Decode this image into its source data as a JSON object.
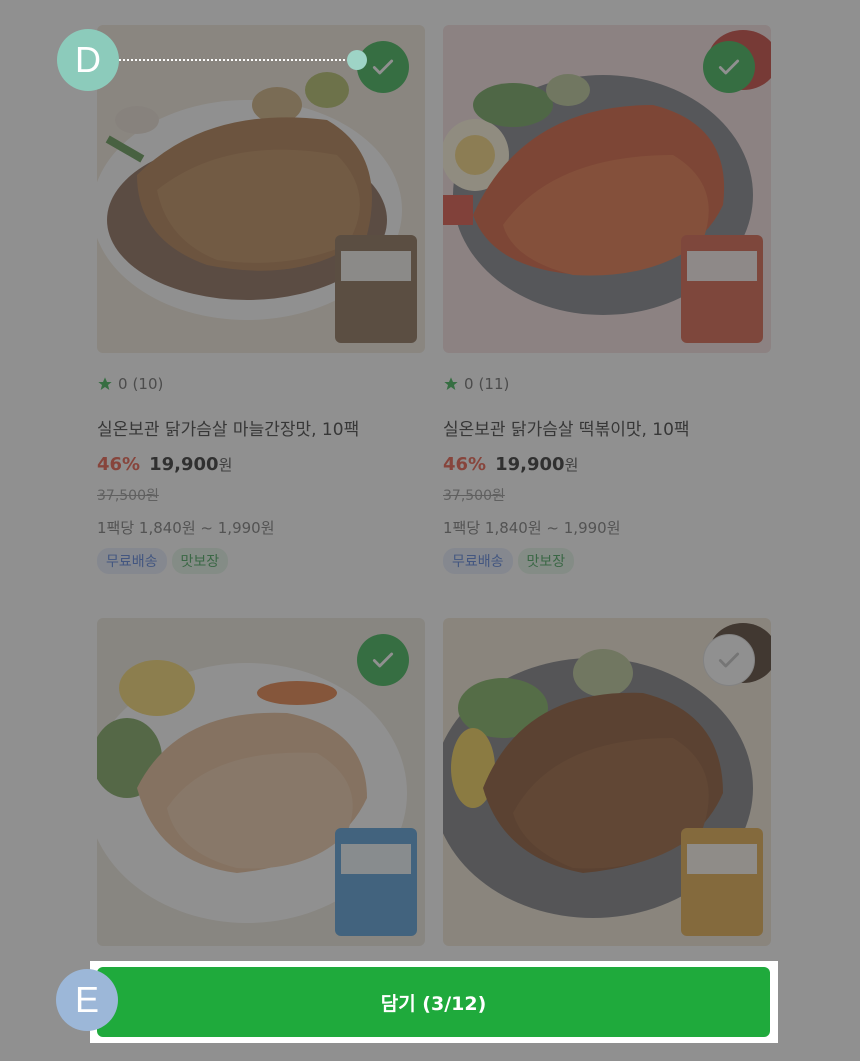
{
  "products": [
    {
      "rating": "0",
      "review_count": "(10)",
      "name": "실온보관 닭가슴살 마늘간장맛, 10팩",
      "discount": "46%",
      "price": "19,900",
      "currency": "원",
      "original_price": "37,500원",
      "unit_price": "1팩당 1,840원 ~ 1,990원",
      "tags": [
        "무료배송",
        "맛보장"
      ],
      "checked": true,
      "package_label": "실온보관 닭가슴살",
      "package_color": "#7a5a3c",
      "bg_color": "#efe6d6",
      "plate_color": "#ffffff",
      "meat_color": "#a66a35"
    },
    {
      "rating": "0",
      "review_count": "(11)",
      "name": "실온보관 닭가슴살 떡볶이맛, 10팩",
      "discount": "46%",
      "price": "19,900",
      "currency": "원",
      "original_price": "37,500원",
      "unit_price": "1팩당 1,840원 ~ 1,990원",
      "tags": [
        "무료배송",
        "맛보장"
      ],
      "checked": true,
      "package_label": "실온보관 닭가슴살",
      "package_color": "#d24a2e",
      "bg_color": "#f4dcdc",
      "plate_color": "#6f7178",
      "meat_color": "#d0481f"
    },
    {
      "checked": true,
      "package_label": "실온보관 닭가슴살",
      "package_color": "#3d8fd1",
      "bg_color": "#ece6da",
      "plate_color": "#ffffff",
      "meat_color": "#e4b48a"
    },
    {
      "checked": false,
      "package_label": "실온보관 닭가슴살",
      "package_color": "#e0a030",
      "bg_color": "#efe3d0",
      "plate_color": "#6b6d72",
      "meat_color": "#7a3e16"
    }
  ],
  "add_button_label": "담기 (3/12)",
  "callouts": {
    "d": "D",
    "e": "E"
  },
  "colors": {
    "accent_green": "#1faa3c",
    "discount_red": "#e8452f"
  }
}
